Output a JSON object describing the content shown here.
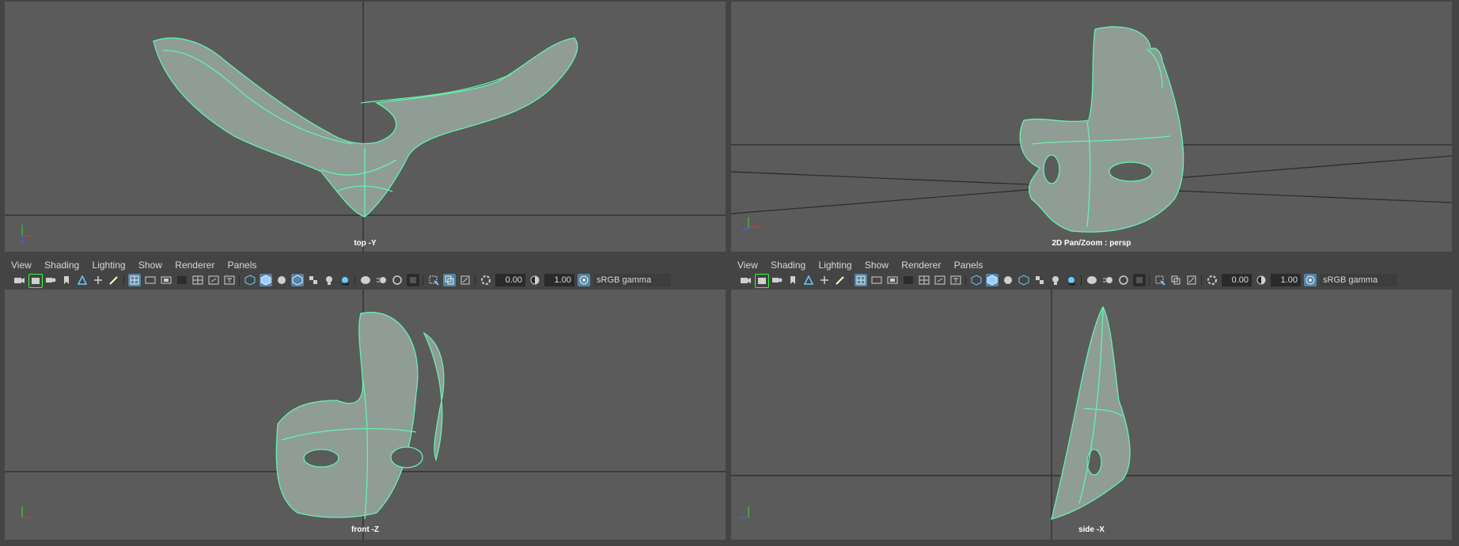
{
  "viewports": {
    "top": {
      "camera_label": "top -Y"
    },
    "persp": {
      "camera_label": "2D Pan/Zoom : persp"
    },
    "front": {
      "camera_label": "front -Z"
    },
    "side": {
      "camera_label": "side -X"
    }
  },
  "left_panel": {
    "menu": [
      "View",
      "Shading",
      "Lighting",
      "Show",
      "Renderer",
      "Panels"
    ],
    "exposure": "0.00",
    "gamma": "1.00",
    "color_space": "sRGB gamma"
  },
  "right_panel": {
    "menu": [
      "View",
      "Shading",
      "Lighting",
      "Show",
      "Renderer",
      "Panels"
    ],
    "exposure": "0.00",
    "gamma": "1.00",
    "color_space": "sRGB gamma"
  },
  "colors": {
    "viewport_bg": "#5b5b5b",
    "wireframe": "#66f2b0",
    "ui_bg": "#444444",
    "active_button": "#5285a6"
  }
}
